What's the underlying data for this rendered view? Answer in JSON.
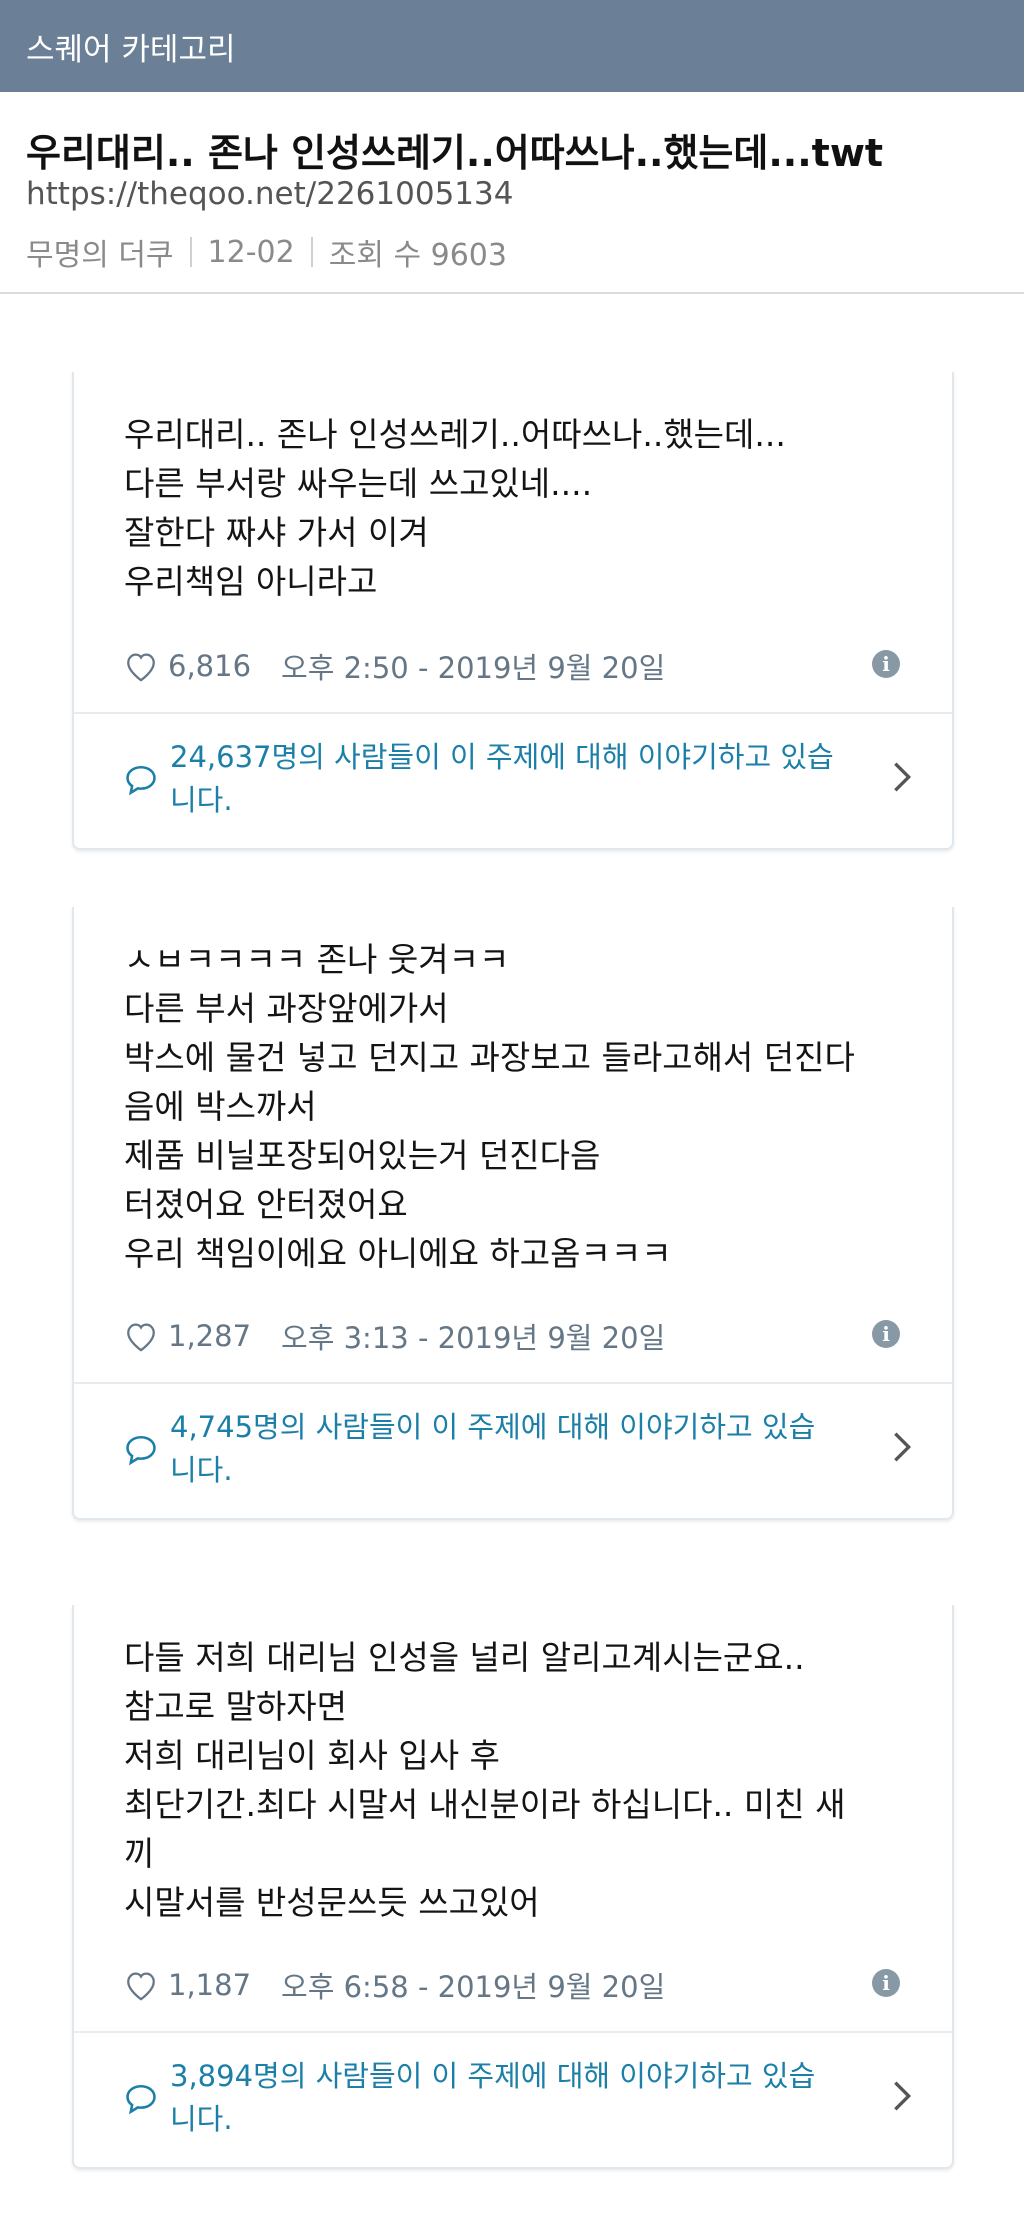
{
  "topbar": {
    "category": "스퀘어 카테고리"
  },
  "post": {
    "title": "우리대리.. 존나 인성쓰레기..어따쓰나..했는데...twt",
    "url": "https://theqoo.net/2261005134",
    "author": "무명의 더쿠",
    "date": "12-02",
    "views": "조회 수 9603"
  },
  "tweets": [
    {
      "lines": [
        "우리대리.. 존나 인성쓰레기..어따쓰나..했는데...",
        "다른 부서랑 싸우는데 쓰고있네....",
        "잘한다 짜샤 가서 이겨",
        "우리책임 아니라고"
      ],
      "likes": "6,816",
      "time": "오후 2:50 - 2019년 9월 20일",
      "conversation": [
        "24,637명의 사람들이 이 주제에 대해 이야기하고 있습",
        "니다."
      ]
    },
    {
      "lines": [
        "ㅅㅂㅋㅋㅋㅋ 존나 웃겨ㅋㅋ",
        "다른 부서 과장앞에가서",
        "박스에 물건 넣고 던지고 과장보고 들라고해서 던진다",
        "음에 박스까서",
        "제품 비닐포장되어있는거 던진다음",
        "터졌어요 안터졌어요",
        "우리 책임이에요 아니에요 하고옴ㅋㅋㅋ"
      ],
      "likes": "1,287",
      "time": "오후 3:13 - 2019년 9월 20일",
      "conversation": [
        "4,745명의 사람들이 이 주제에 대해 이야기하고 있습",
        "니다."
      ]
    },
    {
      "lines": [
        "다들 저희 대리님 인성을 널리 알리고계시는군요..",
        "참고로 말하자면",
        "저희 대리님이 회사 입사 후",
        "최단기간.최다 시말서 내신분이라 하십니다..  미친 새",
        "끼",
        "시말서를 반성문쓰듯 쓰고있어"
      ],
      "likes": "1,187",
      "time": "오후 6:58 - 2019년 9월 20일",
      "conversation": [
        "3,894명의 사람들이 이 주제에 대해 이야기하고 있습",
        "니다."
      ]
    }
  ],
  "icons": {
    "like": "heart-outline-icon",
    "info": "info-icon",
    "conversation": "speech-bubble-icon",
    "more": "chevron-right-icon"
  },
  "colors": {
    "topbar": "#6b8097",
    "link": "#1b7fa8",
    "muted": "#657786"
  }
}
